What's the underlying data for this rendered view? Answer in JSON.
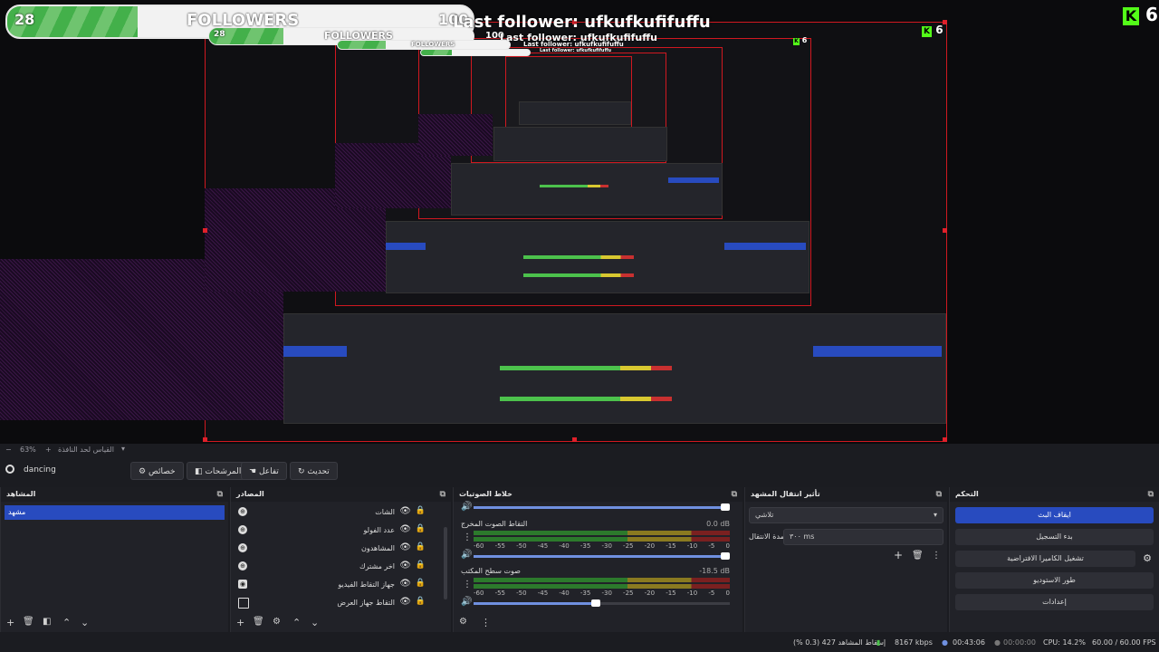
{
  "overlay": {
    "followers_count": "28",
    "followers_label": "FOLLOWERS",
    "followers_goal": "100",
    "last_follower": "Last follower: ufkufkufifuffu",
    "kick_count": "6",
    "kick_logo": "K",
    "progress": 0.28
  },
  "preview_bar": {
    "zoom": "63%",
    "minus": "−",
    "plus": "+",
    "fit_label": "القياس لحد النافذة"
  },
  "scene_toolbar": {
    "scene_name": "dancing",
    "properties": "خصائص",
    "filters": "المرشحات",
    "interact": "تفاعل",
    "refresh": "تحديث"
  },
  "docks": {
    "scenes": {
      "title": "المشاهد",
      "items": [
        "مشهد"
      ]
    },
    "sources": {
      "title": "المصادر",
      "items": [
        {
          "label": "الشات",
          "icon": "globe-icon"
        },
        {
          "label": "عدد الفولو",
          "icon": "globe-icon"
        },
        {
          "label": "المشاهدون",
          "icon": "globe-icon"
        },
        {
          "label": "اخر مشترك",
          "icon": "globe-icon"
        },
        {
          "label": "جهاز التقاط الفيديو",
          "icon": "camera-icon"
        },
        {
          "label": "التقاط جهاز العرض",
          "icon": "monitor-icon"
        }
      ]
    },
    "mixer": {
      "title": "خلاط الصوتيات",
      "channels": [
        {
          "name": "التقاط الصوت المخرج",
          "db": "0.0 dB",
          "level": 0.0,
          "volume": 1.0
        },
        {
          "name": "صوت سطح المكتب",
          "db": "-18.5 dB",
          "level": 0.0,
          "volume": 0.48
        }
      ],
      "scale": [
        "-60",
        "-55",
        "-50",
        "-45",
        "-40",
        "-35",
        "-30",
        "-25",
        "-20",
        "-15",
        "-10",
        "-5",
        "0"
      ]
    },
    "transitions": {
      "title": "تأثير انتقال المشهد",
      "type": "تلاشي",
      "duration_label": "مدة الانتقال",
      "duration": "٣٠٠ ms"
    },
    "controls": {
      "title": "التحكم",
      "buttons": [
        "ايقاف البث",
        "بدء التسجيل",
        "تشغيل الكاميرا الافتراضية",
        "طور الاستوديو",
        "إعدادات"
      ]
    }
  },
  "status": {
    "dropped": "إسقاط المشاهد 427 (0.3 %)",
    "bitrate": "8167 kbps",
    "live_time": "00:43:06",
    "rec_time": "00:00:00",
    "cpu": "CPU: 14.2%",
    "fps": "60.00 / 60.00 FPS"
  },
  "colors": {
    "accent": "#284bbf",
    "selection_border": "#d01820",
    "kick_green": "#53fc18",
    "follow_green": "#43b04a"
  }
}
